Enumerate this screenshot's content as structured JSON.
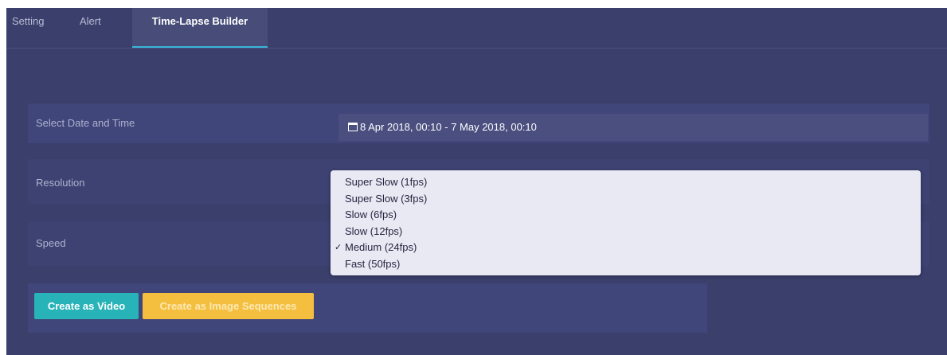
{
  "tabs": [
    {
      "label": "Setting"
    },
    {
      "label": "Alert"
    },
    {
      "label": "Time-Lapse Builder"
    }
  ],
  "active_tab": "Time-Lapse Builder",
  "form": {
    "date_label": "Select Date and Time",
    "date_value": "8 Apr 2018, 00:10 - 7 May 2018, 00:10",
    "resolution_label": "Resolution",
    "speed_label": "Speed"
  },
  "speed_options": [
    {
      "label": "Super Slow (1fps)"
    },
    {
      "label": "Super Slow (3fps)"
    },
    {
      "label": "Slow (6fps)"
    },
    {
      "label": "Slow (12fps)"
    },
    {
      "label": "Medium (24fps)",
      "selected": true
    },
    {
      "label": "Fast (50fps)"
    }
  ],
  "check_mark": "✓",
  "select_arrow": "⇕",
  "buttons": {
    "video": "Create as Video",
    "images": "Create as Image Sequences"
  },
  "colors": {
    "background": "#3a3f6c",
    "active_tab_underline": "#39b6d8",
    "video_button": "#27b3b8",
    "images_button": "#f4bf3f"
  },
  "icons": {
    "date": "calendar-icon",
    "selected": "check-icon",
    "select": "select-arrow-icon"
  }
}
